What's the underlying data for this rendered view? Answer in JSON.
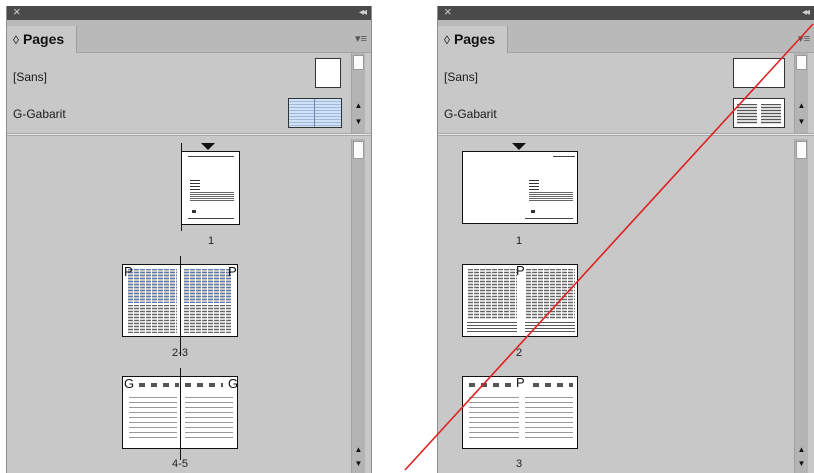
{
  "panels": [
    {
      "title": "Pages",
      "masters": [
        {
          "label": "[Sans]"
        },
        {
          "label": "G-Gabarit"
        }
      ],
      "pages": [
        {
          "label": "1"
        },
        {
          "label": "2-3",
          "left_letter": "P",
          "right_letter": "P"
        },
        {
          "label": "4-5",
          "left_letter": "G",
          "right_letter": "G"
        }
      ]
    },
    {
      "title": "Pages",
      "masters": [
        {
          "label": "[Sans]"
        },
        {
          "label": "G-Gabarit"
        }
      ],
      "pages": [
        {
          "label": "1"
        },
        {
          "label": "2",
          "letter": "P"
        },
        {
          "label": "3",
          "letter": "P"
        }
      ]
    }
  ],
  "icons": {
    "close": "×",
    "collapse": "◂◂",
    "tab_chevron": "◊",
    "panel_menu": "▾≡",
    "scroll_up": "▲",
    "scroll_down": "▼",
    "current_page_marker": "▼"
  },
  "colors": {
    "panel_bg": "#c8c8c8",
    "titlebar": "#4a4a4a",
    "annotation_line": "#e02020",
    "master_thumb_fill": "#d6e6fa"
  }
}
